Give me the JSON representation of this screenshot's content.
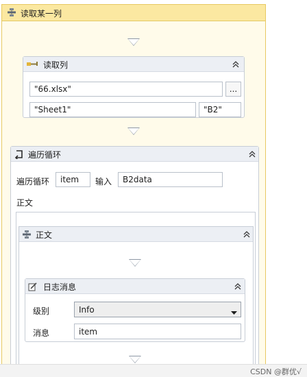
{
  "sequence": {
    "title": "读取某一列",
    "icon": "sequence-icon"
  },
  "read_column": {
    "title": "读取列",
    "icon": "excel-read-column-icon",
    "file_path": "\"66.xlsx\"",
    "browse_label": "...",
    "sheet_name": "\"Sheet1\"",
    "start_cell": "\"B2\""
  },
  "for_each": {
    "title": "遍历循环",
    "icon": "loop-icon",
    "loop_label": "遍历循环",
    "item_value": "item",
    "input_label": "输入",
    "input_value": "B2data",
    "body_label": "正文"
  },
  "body": {
    "title": "正文",
    "icon": "sequence-icon"
  },
  "log_message": {
    "title": "日志消息",
    "icon": "log-message-icon",
    "level_label": "级别",
    "level_value": "Info",
    "message_label": "消息",
    "message_value": "item"
  },
  "watermark": "CSDN @群优√"
}
